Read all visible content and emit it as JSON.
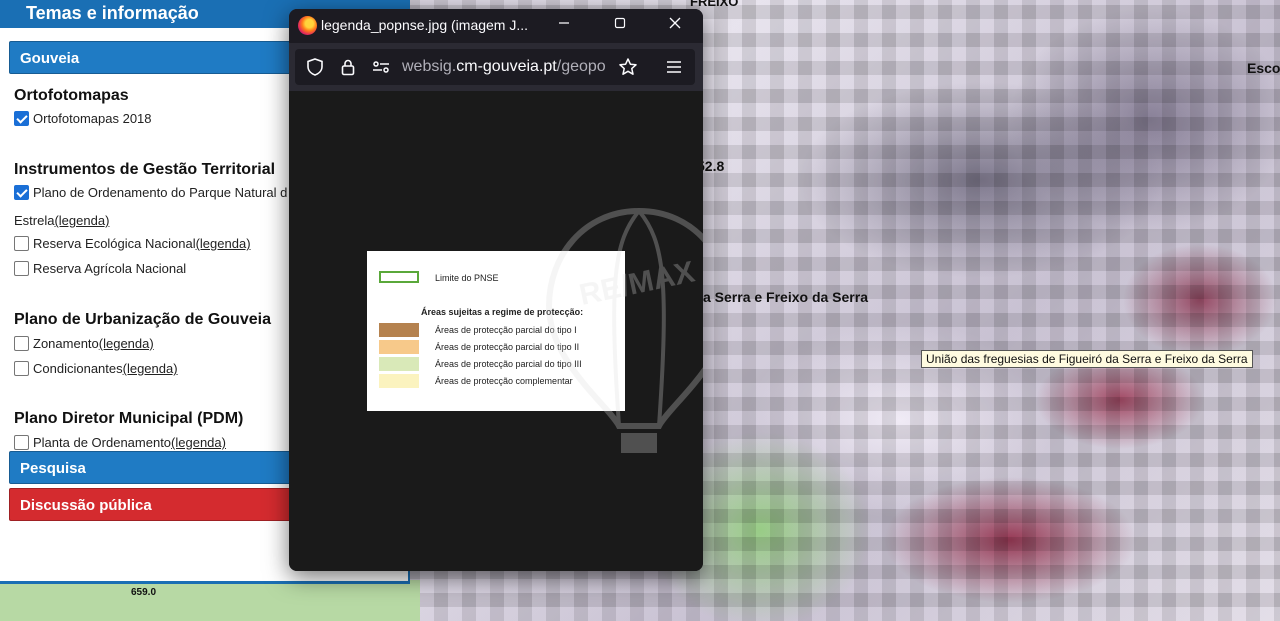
{
  "map": {
    "labels": {
      "top_left": "FREIXO",
      "right_edge": "Esco",
      "elevation": "52.8",
      "parish_partial": "a Serra e Freixo da Serra"
    },
    "tooltip": "União das freguesias de Figueiró da Serra e Freixo da Serra",
    "coordinate": "659.0"
  },
  "panel": {
    "header": "Temas e informação",
    "section_gouveia": "Gouveia",
    "section_pesquisa": "Pesquisa",
    "section_discussao": "Discussão pública",
    "groups": [
      {
        "title": "Ortofotomapas"
      },
      {
        "title": "Instrumentos de Gestão Territorial"
      },
      {
        "title": "Plano de Urbanização de Gouveia"
      },
      {
        "title": "Plano Diretor Municipal (PDM)"
      }
    ],
    "layers": {
      "ortofoto": {
        "label": "Ortofotomapas 2018",
        "checked": true
      },
      "pnse": {
        "label": "Plano de Ordenamento do Parque Natural d",
        "label_cont": "Estrela",
        "link": " (legenda)",
        "checked": true
      },
      "ren": {
        "label": "Reserva Ecológica Nacional",
        "link": " (legenda)",
        "checked": false
      },
      "ran": {
        "label": "Reserva Agrícola Nacional",
        "checked": false
      },
      "zonamento": {
        "label": "Zonamento",
        "link": " (legenda)",
        "checked": false
      },
      "condicionantes": {
        "label": "Condicionantes",
        "link": " (legenda)",
        "checked": false
      },
      "planta": {
        "label": "Planta de Ordenamento",
        "link": " (legenda)",
        "checked": false
      }
    }
  },
  "popup": {
    "window_title": "legenda_popnse.jpg (imagem J...",
    "url_prefix": "websig.",
    "url_host": "cm-gouveia.pt",
    "url_suffix": "/geopo",
    "legend": {
      "limit_label": "Limite do PNSE",
      "heading": "Áreas sujeitas a regime de protecção:",
      "items": [
        {
          "label": "Áreas de protecção parcial do tipo I",
          "color": "#b5824f"
        },
        {
          "label": "Áreas de protecção parcial do tipo II",
          "color": "#f7c98a"
        },
        {
          "label": "Áreas de protecção parcial do tipo III",
          "color": "#d9e9b8"
        },
        {
          "label": "Áreas de protecção complementar",
          "color": "#fbf3bf"
        }
      ],
      "limit_color": "#5aa83a"
    },
    "watermark_text": "RE/MAX"
  }
}
